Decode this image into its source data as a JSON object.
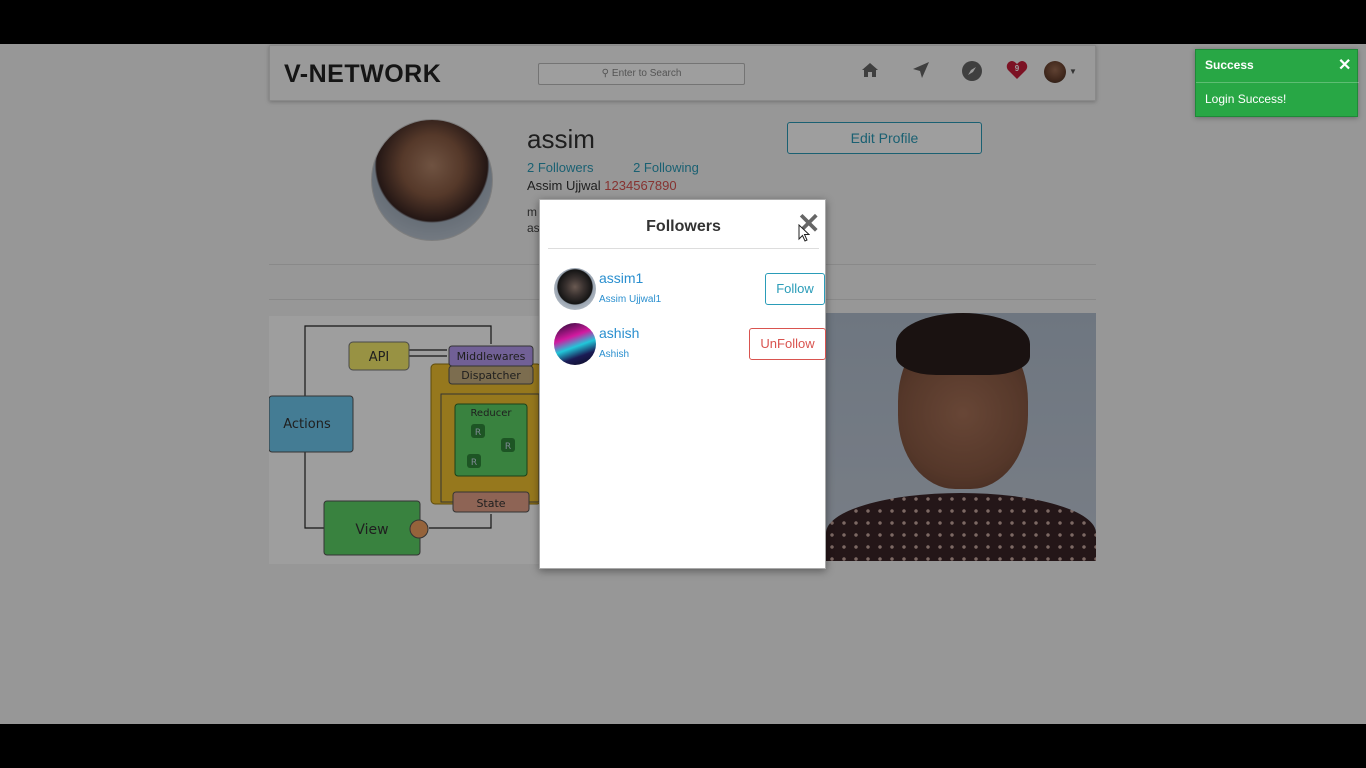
{
  "header": {
    "brand": "V-NETWORK",
    "search_placeholder": "Enter to Search",
    "nav_icons": [
      "home-icon",
      "send-icon",
      "compass-icon",
      "heart-icon",
      "avatar"
    ],
    "notify_count": "9"
  },
  "profile": {
    "username": "assim",
    "followers": "2 Followers",
    "following": "2 Following",
    "fullname": "Assim Ujjwal",
    "phone": "1234567890",
    "bio_line1": "m",
    "bio_line2": "as",
    "edit_label": "Edit Profile"
  },
  "post_diagram": {
    "labels": {
      "api": "API",
      "middlewares": "Middlewares",
      "dispatcher": "Dispatcher",
      "actions": "Actions",
      "reducer": "Reducer",
      "r": "R",
      "state": "State",
      "view": "View"
    }
  },
  "modal": {
    "title": "Followers",
    "close_glyph": "✕",
    "users": [
      {
        "name": "assim1",
        "fullname": "Assim Ujjwal1",
        "button": "Follow"
      },
      {
        "name": "ashish",
        "fullname": "Ashish",
        "button": "UnFollow"
      }
    ]
  },
  "toast": {
    "title": "Success",
    "body": "Login Success!",
    "close_glyph": "✕"
  },
  "colors": {
    "accent": "#2a9cb8",
    "danger": "#d9534f",
    "success": "#28a745",
    "link": "#2a8fcf"
  }
}
